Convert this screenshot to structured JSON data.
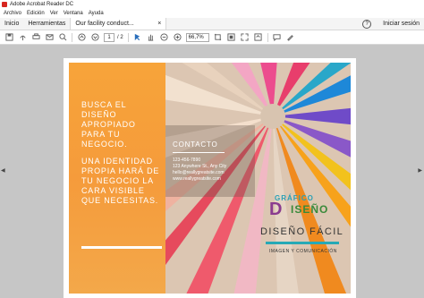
{
  "window": {
    "title": "Adobe Acrobat Reader DC"
  },
  "menu": {
    "items": [
      "Archivo",
      "Edición",
      "Ver",
      "Ventana",
      "Ayuda"
    ]
  },
  "tabs": {
    "home": "Inicio",
    "tools": "Herramientas",
    "doc": "Our facility conduct...",
    "close": "×",
    "help": "?",
    "signin": "Iniciar sesión"
  },
  "toolbar": {
    "page_current": "1",
    "page_total": "/ 2",
    "zoom": "66,7%"
  },
  "brochure": {
    "headline": "BUSCA EL DISEÑO APROPIADO PARA TU NEGOCIO.",
    "body": "UNA IDENTIDAD PROPIA HARÁ DE TU NEGOCIO LA CARA VISIBLE QUE NECESITAS.",
    "contact_label": "CONTACTO",
    "phone": "123-456-7890",
    "address": "123 Anywhere St., Any City",
    "email": "hello@reallygreatsite.com",
    "website": "www.reallygreatsite.com",
    "logo_top": "GRÁFICO",
    "logo_initial": "D",
    "logo_rest": "ISEÑO",
    "title": "DISEÑO FÁCIL",
    "subtitle": "IMAGEN Y COMUNICACIÓN"
  },
  "colors": {
    "orange": "#f59b3b",
    "teal": "#26a9b6",
    "accent_red": "#d7261f"
  },
  "icons": [
    "save-icon",
    "upload-icon",
    "print-icon",
    "email-icon",
    "search-icon",
    "prev-page-icon",
    "next-page-icon",
    "select-icon",
    "hand-icon",
    "zoom-out-icon",
    "zoom-in-icon",
    "crop-icon",
    "fit-icon",
    "fullscreen-icon",
    "rotate-icon",
    "comment-icon",
    "sign-icon"
  ]
}
